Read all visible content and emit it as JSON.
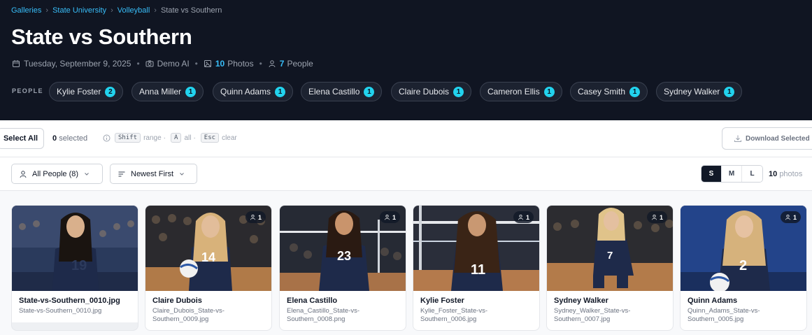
{
  "breadcrumb": {
    "items": [
      "Galleries",
      "State University",
      "Volleyball"
    ],
    "current": "State vs Southern"
  },
  "title": "State vs Southern",
  "meta": {
    "date": "Tuesday, September 9, 2025",
    "camera": "Demo AI",
    "photos_count": "10",
    "photos_label": "Photos",
    "people_count": "7",
    "people_label": "People"
  },
  "people_section": {
    "label": "PEOPLE",
    "chips": [
      {
        "name": "Kylie Foster",
        "count": "2"
      },
      {
        "name": "Anna Miller",
        "count": "1"
      },
      {
        "name": "Quinn Adams",
        "count": "1"
      },
      {
        "name": "Elena Castillo",
        "count": "1"
      },
      {
        "name": "Claire Dubois",
        "count": "1"
      },
      {
        "name": "Cameron Ellis",
        "count": "1"
      },
      {
        "name": "Casey Smith",
        "count": "1"
      },
      {
        "name": "Sydney Walker",
        "count": "1"
      }
    ]
  },
  "selection": {
    "select_all": "Select All",
    "count": "0",
    "selected_label": "selected",
    "hint_shift": "Shift",
    "hint_range": "range",
    "hint_a": "A",
    "hint_all": "all",
    "hint_esc": "Esc",
    "hint_clear": "clear",
    "dot": "·",
    "download": "Download Selected"
  },
  "filters": {
    "people": "All People (8)",
    "sort": "Newest First",
    "sizes": [
      "S",
      "M",
      "L"
    ],
    "active_size": "S",
    "count": "10",
    "count_label": "photos"
  },
  "photos": [
    {
      "title": "State-vs-Southern_0010.jpg",
      "file": "State-vs-Southern_0010.jpg",
      "people": "",
      "jersey": "19"
    },
    {
      "title": "Claire Dubois",
      "file": "Claire_Dubois_State-vs-Southern_0009.jpg",
      "people": "1",
      "jersey": "14"
    },
    {
      "title": "Elena Castillo",
      "file": "Elena_Castillo_State-vs-Southern_0008.png",
      "people": "1",
      "jersey": "23"
    },
    {
      "title": "Kylie Foster",
      "file": "Kylie_Foster_State-vs-Southern_0006.jpg",
      "people": "1",
      "jersey": "11"
    },
    {
      "title": "Sydney Walker",
      "file": "Sydney_Walker_State-vs-Southern_0007.jpg",
      "people": "1",
      "jersey": "7"
    },
    {
      "title": "Quinn Adams",
      "file": "Quinn_Adams_State-vs-Southern_0005.jpg",
      "people": "1",
      "jersey": "2"
    }
  ],
  "colors": {
    "header_bg": "#101522",
    "accent": "#22d3ee",
    "link": "#38bdf8",
    "jersey": "#1e2a4a"
  }
}
